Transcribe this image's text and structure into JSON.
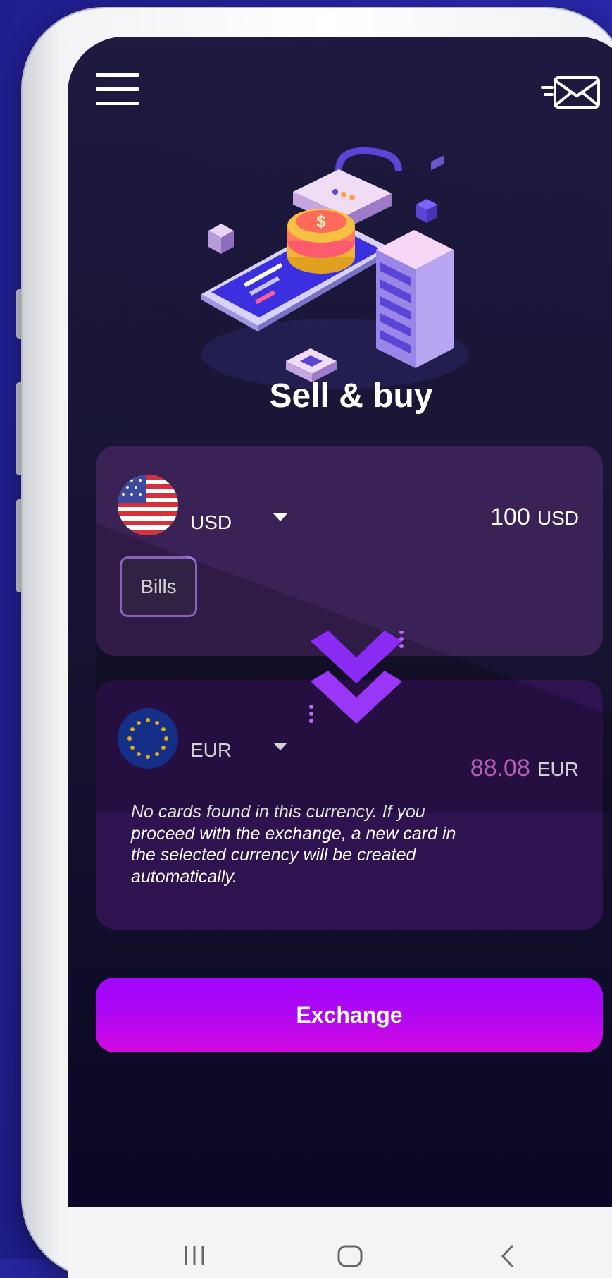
{
  "screen": {
    "title": "Sell & buy"
  },
  "from": {
    "currency": "USD",
    "amount": "100",
    "amount_unit": "USD",
    "bills_label": "Bills"
  },
  "to": {
    "currency": "EUR",
    "amount": "88.08",
    "amount_unit": "EUR",
    "notice": "No cards found in this currency. If you proceed with the exchange, a new card in the selected currency will be created automatically."
  },
  "actions": {
    "exchange_label": "Exchange"
  },
  "icons": {
    "menu": "hamburger-menu-icon",
    "mail": "mail-icon",
    "swap": "double-chevron-down-icon",
    "nav": [
      "recent-apps-icon",
      "home-icon",
      "back-icon"
    ]
  },
  "colors": {
    "accent": "#9f07ff",
    "accent_end": "#d40ae0",
    "converted_amount": "#e070e0",
    "bills_border": "#a878e6"
  }
}
